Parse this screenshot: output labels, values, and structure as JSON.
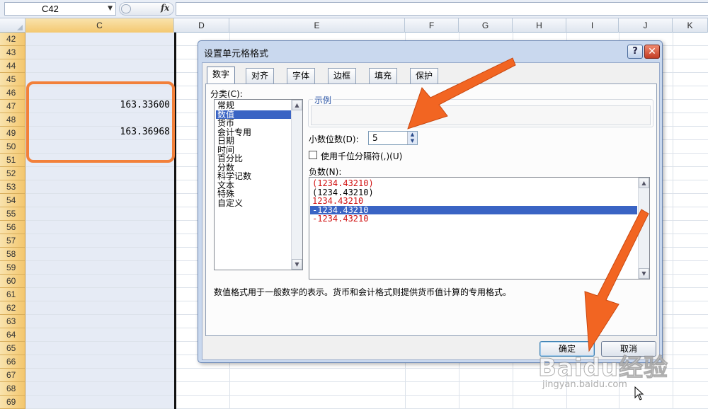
{
  "formula_bar": {
    "name_box": "C42",
    "fx_symbol": "fx",
    "formula": ""
  },
  "columns": [
    "C",
    "D",
    "E",
    "F",
    "G",
    "H",
    "I",
    "J",
    "K"
  ],
  "rows": [
    "42",
    "43",
    "44",
    "45",
    "46",
    "47",
    "48",
    "49",
    "50",
    "51",
    "52",
    "53",
    "54",
    "55",
    "56",
    "57",
    "58",
    "59",
    "60",
    "61",
    "62",
    "63",
    "64",
    "65",
    "66",
    "67",
    "68",
    "69"
  ],
  "cells": {
    "C47": "163.33600",
    "C49": "163.36968"
  },
  "dialog": {
    "title": "设置单元格格式",
    "help": "?",
    "close": "✕",
    "tabs": [
      "数字",
      "对齐",
      "字体",
      "边框",
      "填充",
      "保护"
    ],
    "active_tab": "数字",
    "category_label": "分类(C):",
    "categories": [
      "常规",
      "数值",
      "货币",
      "会计专用",
      "日期",
      "时间",
      "百分比",
      "分数",
      "科学记数",
      "文本",
      "特殊",
      "自定义"
    ],
    "selected_category": "数值",
    "sample_label": "示例",
    "sample_value": "",
    "decimal_label": "小数位数(D):",
    "decimal_value": "5",
    "thousands_label": "使用千位分隔符(,)(U)",
    "thousands_checked": false,
    "negative_label": "负数(N):",
    "negative_numbers": [
      {
        "text": "(1234.43210)",
        "color": "#d01010"
      },
      {
        "text": "(1234.43210)",
        "color": "#000000"
      },
      {
        "text": "1234.43210",
        "color": "#d01010"
      },
      {
        "text": "-1234.43210",
        "color": "#ffffff",
        "selected": true
      },
      {
        "text": "-1234.43210",
        "color": "#d01010"
      }
    ],
    "description": "数值格式用于一般数字的表示。货币和会计格式则提供货币值计算的专用格式。",
    "ok_label": "确定",
    "cancel_label": "取消"
  },
  "watermark": {
    "logo": "Baidu经验",
    "url": "jingyan.baidu.com"
  },
  "colors": {
    "accent_orange": "#f2803a",
    "selection_blue": "#3a64c4",
    "row_header": "#f6cf7e"
  }
}
